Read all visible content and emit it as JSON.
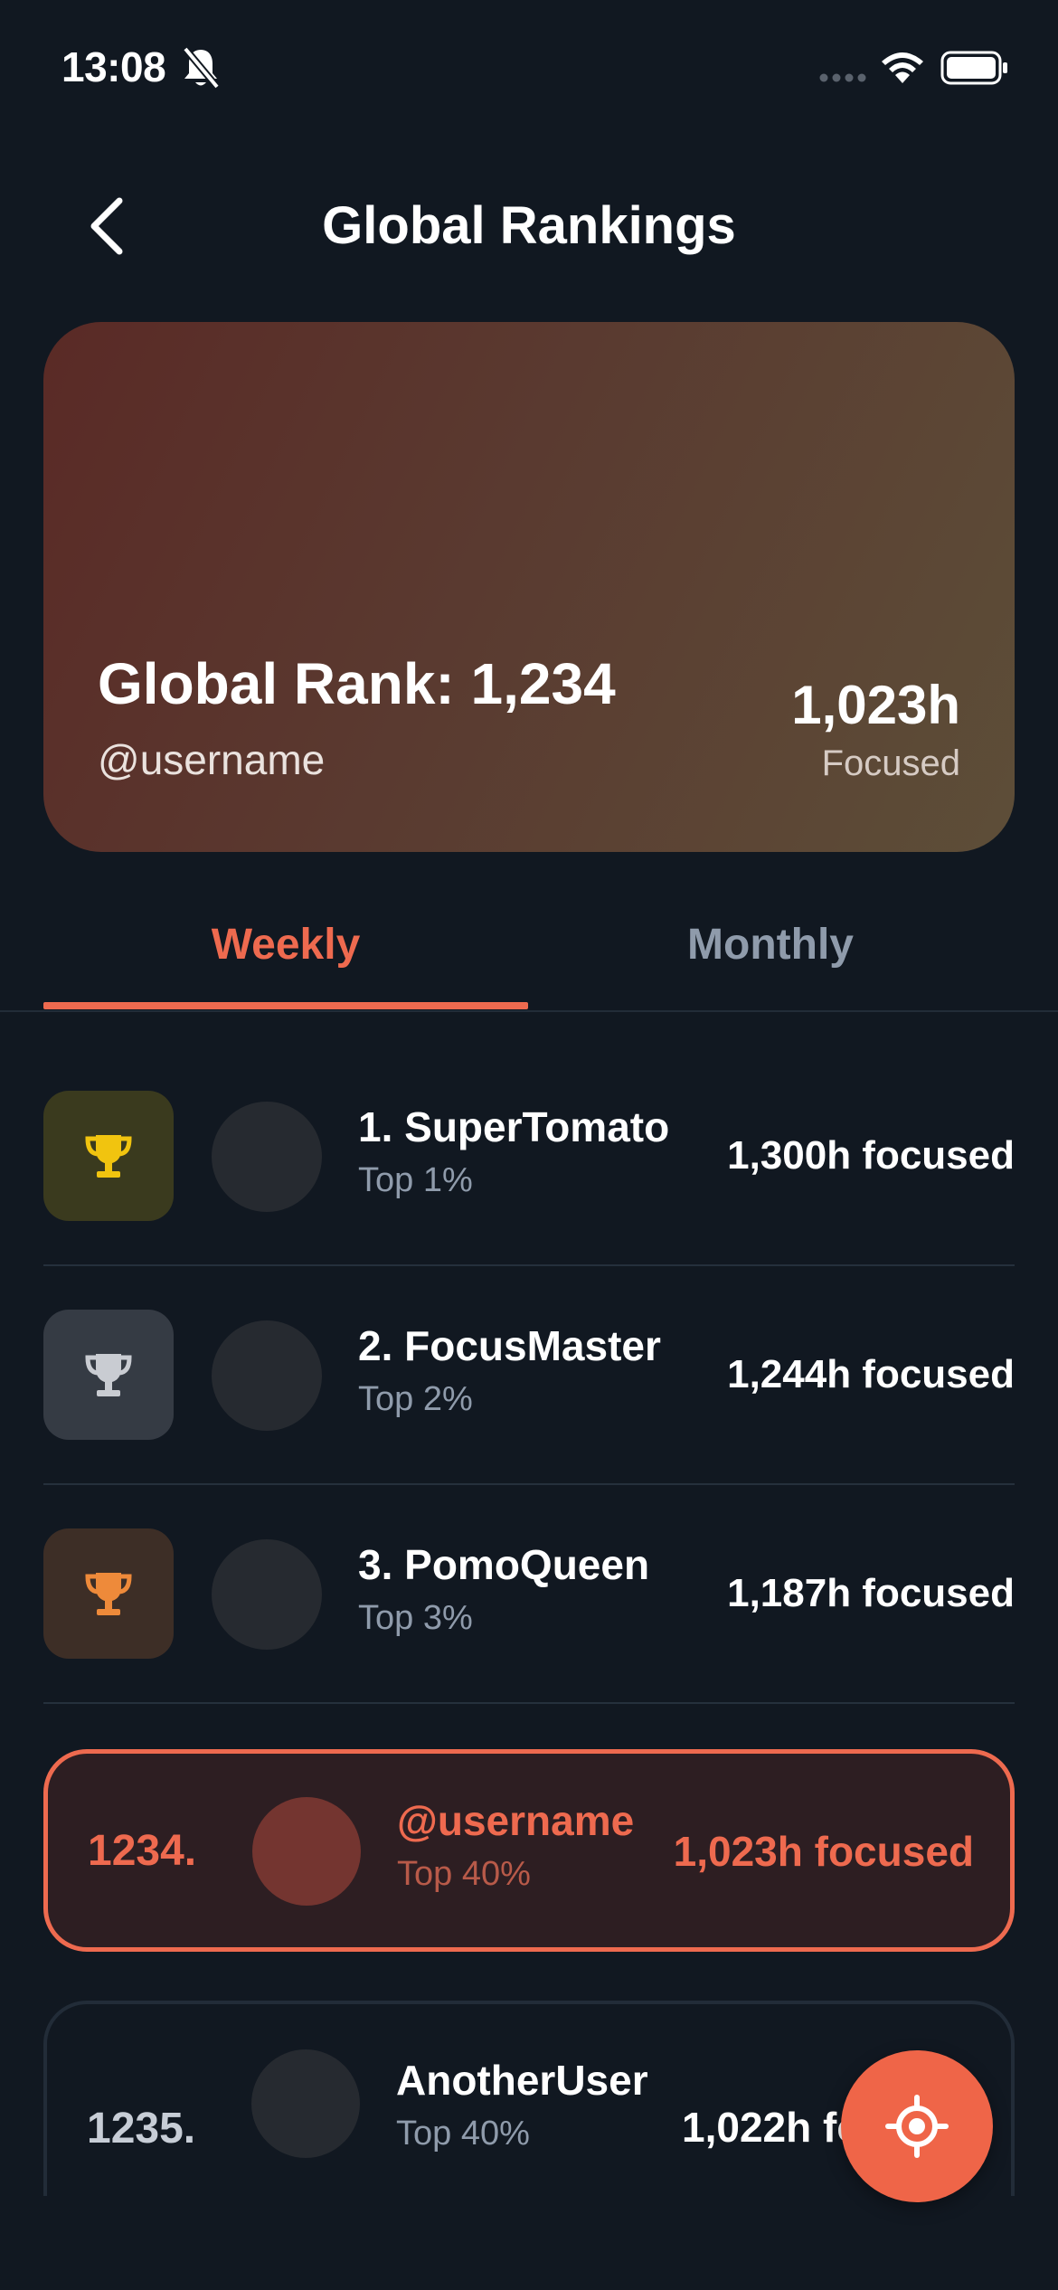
{
  "status_bar": {
    "time": "13:08",
    "icons": [
      "bell-slash-icon",
      "signal-dots-icon",
      "wifi-icon",
      "battery-icon"
    ]
  },
  "header": {
    "title": "Global Rankings",
    "back_icon": "chevron-left-icon"
  },
  "hero": {
    "rank_text": "Global Rank: 1,234",
    "username": "@username",
    "hours": "1,023h",
    "hours_label": "Focused"
  },
  "tabs": [
    {
      "label": "Weekly",
      "active": true
    },
    {
      "label": "Monthly",
      "active": false
    }
  ],
  "top_rankings": [
    {
      "name": "1. SuperTomato",
      "percentile": "Top 1%",
      "hours": "1,300h focused",
      "trophy": "trophy-gold-icon"
    },
    {
      "name": "2. FocusMaster",
      "percentile": "Top 2%",
      "hours": "1,244h focused",
      "trophy": "trophy-silver-icon"
    },
    {
      "name": "3. PomoQueen",
      "percentile": "Top 3%",
      "hours": "1,187h focused",
      "trophy": "trophy-bronze-icon"
    }
  ],
  "current_user": {
    "position": "1234.",
    "name": "@username",
    "percentile": "Top 40%",
    "hours": "1,023h focused"
  },
  "next_user": {
    "position": "1235.",
    "name": "AnotherUser",
    "percentile": "Top 40%",
    "hours": "1,022h focused"
  },
  "fab": {
    "icon": "locate-target-icon"
  },
  "colors": {
    "background": "#111821",
    "accent": "#ee6a4f",
    "muted_text": "#8f9bab",
    "gold": "#f1c40f",
    "silver": "#c9ccd2",
    "bronze": "#ee8a3a"
  }
}
